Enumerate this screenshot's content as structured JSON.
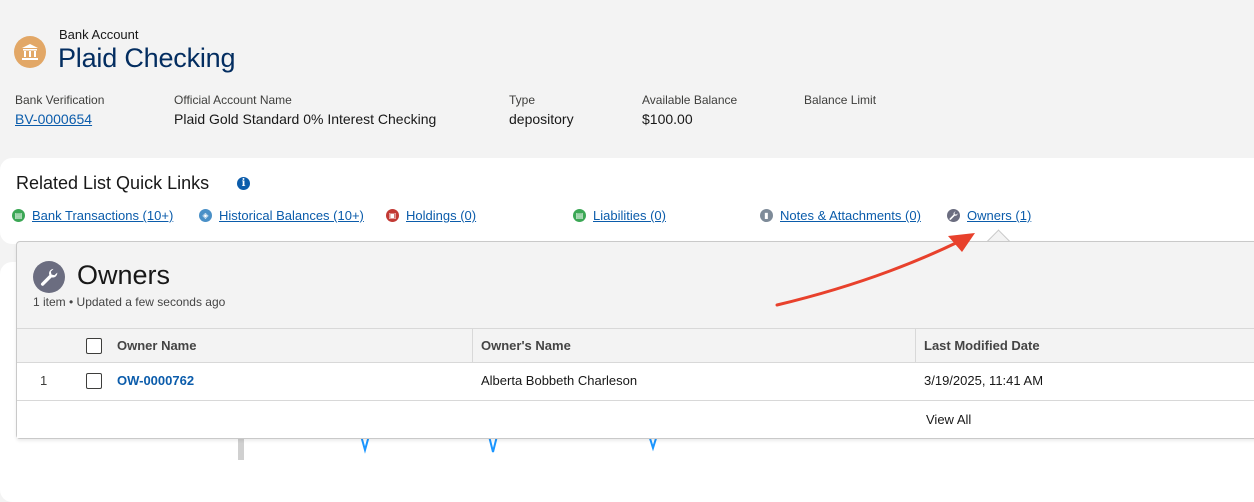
{
  "header": {
    "object_type": "Bank Account",
    "title": "Plaid Checking",
    "fields": [
      {
        "label": "Bank Verification",
        "value": "BV-0000654",
        "is_link": true
      },
      {
        "label": "Official Account Name",
        "value": "Plaid Gold Standard 0% Interest Checking",
        "is_link": false
      },
      {
        "label": "Type",
        "value": "depository",
        "is_link": false
      },
      {
        "label": "Available Balance",
        "value": "$100.00",
        "is_link": false
      },
      {
        "label": "Balance Limit",
        "value": "",
        "is_link": false
      }
    ]
  },
  "quick_links": {
    "title": "Related List Quick Links",
    "items": [
      {
        "label": "Bank Transactions (10+)",
        "icon": "bank-transactions-icon",
        "color": "#3ba755"
      },
      {
        "label": "Historical Balances (10+)",
        "icon": "historical-balances-icon",
        "color": "#4a90c7"
      },
      {
        "label": "Holdings (0)",
        "icon": "holdings-icon",
        "color": "#c23934"
      },
      {
        "label": "Liabilities (0)",
        "icon": "liabilities-icon",
        "color": "#3ba755"
      },
      {
        "label": "Notes & Attachments (0)",
        "icon": "notes-attachments-icon",
        "color": "#7e8b99"
      },
      {
        "label": "Owners (1)",
        "icon": "wrench-icon",
        "color": "#6b6d80"
      }
    ]
  },
  "owners_panel": {
    "title": "Owners",
    "meta": "1 item • Updated a few seconds ago",
    "columns": [
      "Owner Name",
      "Owner's Name",
      "Last Modified Date"
    ],
    "rows": [
      {
        "num": "1",
        "owner_name": "OW-0000762",
        "owners_name": "Alberta Bobbeth Charleson",
        "last_modified": "3/19/2025, 11:41 AM"
      }
    ],
    "view_all": "View All"
  },
  "colors": {
    "link": "#0b5cab",
    "title": "#032d60",
    "bank_icon": "#e2a766",
    "annotation_arrow": "#e8412c"
  }
}
